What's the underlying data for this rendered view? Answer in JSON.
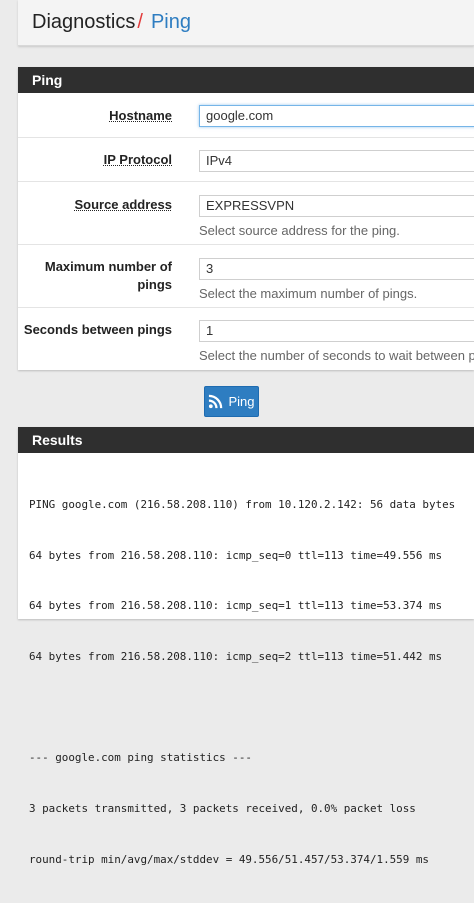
{
  "breadcrumb": {
    "root": "Diagnostics",
    "separator": "/",
    "current": "Ping"
  },
  "ping_panel": {
    "heading": "Ping",
    "fields": {
      "hostname": {
        "label": "Hostname",
        "value": "google.com"
      },
      "ip_protocol": {
        "label": "IP Protocol",
        "value": "IPv4"
      },
      "source_address": {
        "label": "Source address",
        "value": "EXPRESSVPN",
        "help": "Select source address for the ping."
      },
      "max_pings": {
        "label_line1": "Maximum number of",
        "label_line2": "pings",
        "value": "3",
        "help": "Select the maximum number of pings."
      },
      "seconds_between": {
        "label": "Seconds between pings",
        "value": "1",
        "help": "Select the number of seconds to wait between pi"
      }
    },
    "ping_button_label": "Ping"
  },
  "results_panel": {
    "heading": "Results",
    "lines": [
      "PING google.com (216.58.208.110) from 10.120.2.142: 56 data bytes",
      "64 bytes from 216.58.208.110: icmp_seq=0 ttl=113 time=49.556 ms",
      "64 bytes from 216.58.208.110: icmp_seq=1 ttl=113 time=53.374 ms",
      "64 bytes from 216.58.208.110: icmp_seq=2 ttl=113 time=51.442 ms",
      "",
      "--- google.com ping statistics ---",
      "3 packets transmitted, 3 packets received, 0.0% packet loss",
      "round-trip min/avg/max/stddev = 49.556/51.457/53.374/1.559 ms"
    ]
  },
  "colors": {
    "accent": "#2e7dc1",
    "separator": "#e23b3b",
    "panel_heading": "#2f2f2f",
    "background": "#ebebeb"
  },
  "icons": {
    "ping_button": "rss-icon"
  }
}
